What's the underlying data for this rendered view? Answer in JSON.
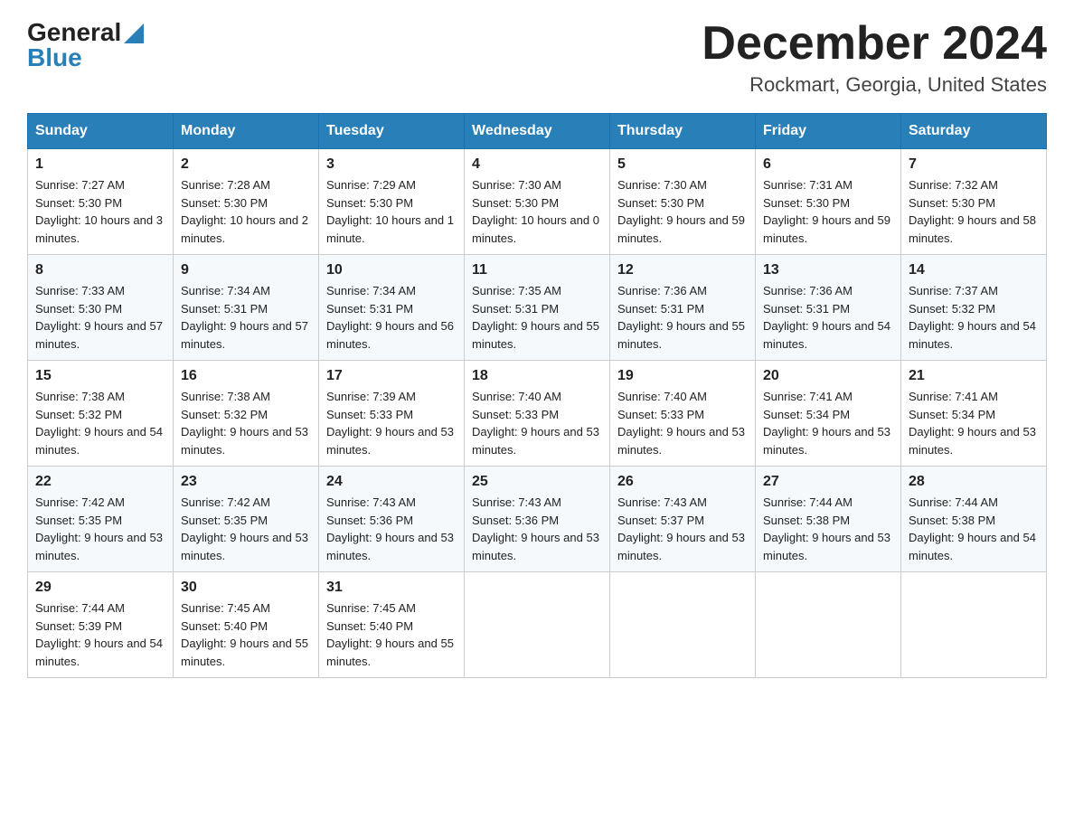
{
  "header": {
    "logo_general": "General",
    "logo_blue": "Blue",
    "month_title": "December 2024",
    "location": "Rockmart, Georgia, United States"
  },
  "days_of_week": [
    "Sunday",
    "Monday",
    "Tuesday",
    "Wednesday",
    "Thursday",
    "Friday",
    "Saturday"
  ],
  "weeks": [
    [
      {
        "day": "1",
        "sunrise": "7:27 AM",
        "sunset": "5:30 PM",
        "daylight": "10 hours and 3 minutes."
      },
      {
        "day": "2",
        "sunrise": "7:28 AM",
        "sunset": "5:30 PM",
        "daylight": "10 hours and 2 minutes."
      },
      {
        "day": "3",
        "sunrise": "7:29 AM",
        "sunset": "5:30 PM",
        "daylight": "10 hours and 1 minute."
      },
      {
        "day": "4",
        "sunrise": "7:30 AM",
        "sunset": "5:30 PM",
        "daylight": "10 hours and 0 minutes."
      },
      {
        "day": "5",
        "sunrise": "7:30 AM",
        "sunset": "5:30 PM",
        "daylight": "9 hours and 59 minutes."
      },
      {
        "day": "6",
        "sunrise": "7:31 AM",
        "sunset": "5:30 PM",
        "daylight": "9 hours and 59 minutes."
      },
      {
        "day": "7",
        "sunrise": "7:32 AM",
        "sunset": "5:30 PM",
        "daylight": "9 hours and 58 minutes."
      }
    ],
    [
      {
        "day": "8",
        "sunrise": "7:33 AM",
        "sunset": "5:30 PM",
        "daylight": "9 hours and 57 minutes."
      },
      {
        "day": "9",
        "sunrise": "7:34 AM",
        "sunset": "5:31 PM",
        "daylight": "9 hours and 57 minutes."
      },
      {
        "day": "10",
        "sunrise": "7:34 AM",
        "sunset": "5:31 PM",
        "daylight": "9 hours and 56 minutes."
      },
      {
        "day": "11",
        "sunrise": "7:35 AM",
        "sunset": "5:31 PM",
        "daylight": "9 hours and 55 minutes."
      },
      {
        "day": "12",
        "sunrise": "7:36 AM",
        "sunset": "5:31 PM",
        "daylight": "9 hours and 55 minutes."
      },
      {
        "day": "13",
        "sunrise": "7:36 AM",
        "sunset": "5:31 PM",
        "daylight": "9 hours and 54 minutes."
      },
      {
        "day": "14",
        "sunrise": "7:37 AM",
        "sunset": "5:32 PM",
        "daylight": "9 hours and 54 minutes."
      }
    ],
    [
      {
        "day": "15",
        "sunrise": "7:38 AM",
        "sunset": "5:32 PM",
        "daylight": "9 hours and 54 minutes."
      },
      {
        "day": "16",
        "sunrise": "7:38 AM",
        "sunset": "5:32 PM",
        "daylight": "9 hours and 53 minutes."
      },
      {
        "day": "17",
        "sunrise": "7:39 AM",
        "sunset": "5:33 PM",
        "daylight": "9 hours and 53 minutes."
      },
      {
        "day": "18",
        "sunrise": "7:40 AM",
        "sunset": "5:33 PM",
        "daylight": "9 hours and 53 minutes."
      },
      {
        "day": "19",
        "sunrise": "7:40 AM",
        "sunset": "5:33 PM",
        "daylight": "9 hours and 53 minutes."
      },
      {
        "day": "20",
        "sunrise": "7:41 AM",
        "sunset": "5:34 PM",
        "daylight": "9 hours and 53 minutes."
      },
      {
        "day": "21",
        "sunrise": "7:41 AM",
        "sunset": "5:34 PM",
        "daylight": "9 hours and 53 minutes."
      }
    ],
    [
      {
        "day": "22",
        "sunrise": "7:42 AM",
        "sunset": "5:35 PM",
        "daylight": "9 hours and 53 minutes."
      },
      {
        "day": "23",
        "sunrise": "7:42 AM",
        "sunset": "5:35 PM",
        "daylight": "9 hours and 53 minutes."
      },
      {
        "day": "24",
        "sunrise": "7:43 AM",
        "sunset": "5:36 PM",
        "daylight": "9 hours and 53 minutes."
      },
      {
        "day": "25",
        "sunrise": "7:43 AM",
        "sunset": "5:36 PM",
        "daylight": "9 hours and 53 minutes."
      },
      {
        "day": "26",
        "sunrise": "7:43 AM",
        "sunset": "5:37 PM",
        "daylight": "9 hours and 53 minutes."
      },
      {
        "day": "27",
        "sunrise": "7:44 AM",
        "sunset": "5:38 PM",
        "daylight": "9 hours and 53 minutes."
      },
      {
        "day": "28",
        "sunrise": "7:44 AM",
        "sunset": "5:38 PM",
        "daylight": "9 hours and 54 minutes."
      }
    ],
    [
      {
        "day": "29",
        "sunrise": "7:44 AM",
        "sunset": "5:39 PM",
        "daylight": "9 hours and 54 minutes."
      },
      {
        "day": "30",
        "sunrise": "7:45 AM",
        "sunset": "5:40 PM",
        "daylight": "9 hours and 55 minutes."
      },
      {
        "day": "31",
        "sunrise": "7:45 AM",
        "sunset": "5:40 PM",
        "daylight": "9 hours and 55 minutes."
      },
      null,
      null,
      null,
      null
    ]
  ],
  "labels": {
    "sunrise_prefix": "Sunrise: ",
    "sunset_prefix": "Sunset: ",
    "daylight_prefix": "Daylight: "
  }
}
